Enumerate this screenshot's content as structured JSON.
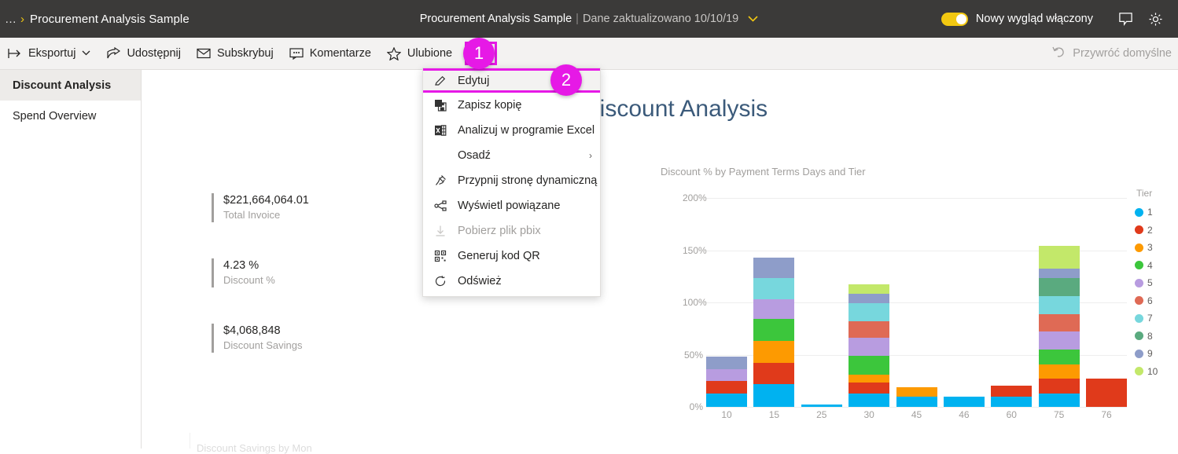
{
  "topbar": {
    "breadcrumb_ellipsis": "…",
    "breadcrumb_chevron": "›",
    "breadcrumb_title": "Procurement Analysis Sample",
    "report_title": "Procurement Analysis Sample",
    "title_separator": "|",
    "refresh_stamp": "Dane zaktualizowano 10/10/19",
    "title_chevron": "⌄",
    "toggle_label": "Nowy wygląd włączony",
    "toggle_on": true,
    "comment_icon": "comment-icon",
    "settings_icon": "gear-icon",
    "background": "#3b3a39",
    "accent": "#f2c811"
  },
  "toolbar": {
    "items": [
      {
        "label": "Eksportuj",
        "icon": "export-icon",
        "has_caret": true
      },
      {
        "label": "Udostępnij",
        "icon": "share-icon",
        "has_caret": false
      },
      {
        "label": "Subskrybuj",
        "icon": "envelope-icon",
        "has_caret": false
      },
      {
        "label": "Komentarze",
        "icon": "comment-icon",
        "has_caret": false
      },
      {
        "label": "Ulubione",
        "icon": "star-icon",
        "has_caret": false
      }
    ],
    "more_label": "···",
    "restore_default_label": "Przywróć domyślne",
    "restore_default_icon": "undo-icon",
    "highlight_color": "#e619e6"
  },
  "leftnav": {
    "items": [
      {
        "label": "Discount Analysis",
        "selected": true
      },
      {
        "label": "Spend Overview",
        "selected": false
      }
    ]
  },
  "menu": {
    "items": [
      {
        "label": "Edytuj",
        "icon": "pencil-icon",
        "disabled": false,
        "submenu": false,
        "highlighted": true
      },
      {
        "label": "Zapisz kopię",
        "icon": "save-copy-icon",
        "disabled": false,
        "submenu": false,
        "highlighted": false
      },
      {
        "label": "Analizuj w programie Excel",
        "icon": "excel-icon",
        "disabled": false,
        "submenu": false,
        "highlighted": false
      },
      {
        "label": "Osadź",
        "icon": "none",
        "disabled": false,
        "submenu": true,
        "highlighted": false
      },
      {
        "label": "Przypnij stronę dynamiczną",
        "icon": "pin-icon",
        "disabled": false,
        "submenu": false,
        "highlighted": false
      },
      {
        "label": "Wyświetl powiązane",
        "icon": "related-icon",
        "disabled": false,
        "submenu": false,
        "highlighted": false
      },
      {
        "label": "Pobierz plik pbix",
        "icon": "download-icon",
        "disabled": true,
        "submenu": false,
        "highlighted": false
      },
      {
        "label": "Generuj kod QR",
        "icon": "qr-icon",
        "disabled": false,
        "submenu": false,
        "highlighted": false
      },
      {
        "label": "Odśwież",
        "icon": "refresh-icon",
        "disabled": false,
        "submenu": false,
        "highlighted": false
      }
    ],
    "submenu_caret": "›"
  },
  "callouts": [
    {
      "number": "1"
    },
    {
      "number": "2"
    }
  ],
  "report": {
    "heading": "Discount Analysis",
    "kpis": [
      {
        "value": "$221,664,064.01",
        "label": "Total Invoice"
      },
      {
        "value": "4.23 %",
        "label": "Discount %"
      },
      {
        "value": "$4,068,848",
        "label": "Discount Savings"
      }
    ],
    "bottom_tile_title": "Discount Savings by Mon"
  },
  "chart_data": {
    "type": "bar",
    "stacked": true,
    "title": "Discount % by Payment Terms Days and Tier",
    "xlabel": "",
    "ylabel": "",
    "categories": [
      "10",
      "15",
      "25",
      "30",
      "45",
      "46",
      "60",
      "75",
      "76"
    ],
    "ylim": [
      0,
      200
    ],
    "yticks": [
      0,
      50,
      100,
      150,
      200
    ],
    "ytick_labels": [
      "0%",
      "50%",
      "100%",
      "150%",
      "200%"
    ],
    "grid": true,
    "legend_title": "Tier",
    "legend_position": "right",
    "series": [
      {
        "name": "1",
        "color": "#00b2f0",
        "values": [
          13,
          22,
          2,
          13,
          10,
          10,
          10,
          13,
          0
        ]
      },
      {
        "name": "2",
        "color": "#e03a1b",
        "values": [
          12,
          20,
          0,
          10,
          0,
          0,
          10,
          14,
          27
        ]
      },
      {
        "name": "3",
        "color": "#fd9a01",
        "values": [
          0,
          21,
          0,
          8,
          9,
          0,
          0,
          14,
          0
        ]
      },
      {
        "name": "4",
        "color": "#3cc63c",
        "values": [
          0,
          21,
          0,
          18,
          0,
          0,
          0,
          14,
          0
        ]
      },
      {
        "name": "5",
        "color": "#b89ce0",
        "values": [
          11,
          19,
          0,
          17,
          0,
          0,
          0,
          17,
          0
        ]
      },
      {
        "name": "6",
        "color": "#df6a55",
        "values": [
          0,
          0,
          0,
          16,
          0,
          0,
          0,
          17,
          0
        ]
      },
      {
        "name": "7",
        "color": "#77d7dd",
        "values": [
          0,
          20,
          0,
          17,
          0,
          0,
          0,
          17,
          0
        ]
      },
      {
        "name": "8",
        "color": "#5aaa7f",
        "values": [
          0,
          0,
          0,
          0,
          0,
          0,
          0,
          17,
          0
        ]
      },
      {
        "name": "9",
        "color": "#8e9dc9",
        "values": [
          12,
          20,
          0,
          9,
          0,
          0,
          0,
          9,
          0
        ]
      },
      {
        "name": "10",
        "color": "#c3e86a",
        "values": [
          0,
          0,
          0,
          9,
          0,
          0,
          0,
          22,
          0
        ]
      }
    ]
  }
}
